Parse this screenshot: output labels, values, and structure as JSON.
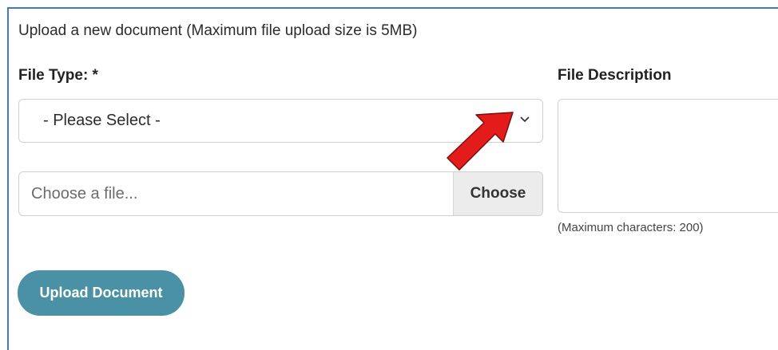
{
  "form": {
    "heading": "Upload a new document (Maximum file upload size is 5MB)",
    "file_type_label": "File Type: *",
    "file_type_select": {
      "selected": "- Please Select -"
    },
    "file_input": {
      "placeholder": "Choose a file...",
      "button_label": "Choose"
    },
    "description_label": "File Description",
    "description_hint": "(Maximum characters: 200)",
    "submit_label": "Upload Document"
  },
  "colors": {
    "frame_border": "#4a74c9",
    "submit_button": "#4a91a5",
    "annotation_arrow": "#e41b1b"
  },
  "icons": {
    "select_chevron": "chevron-down-icon",
    "annotation": "red-arrow-icon"
  }
}
